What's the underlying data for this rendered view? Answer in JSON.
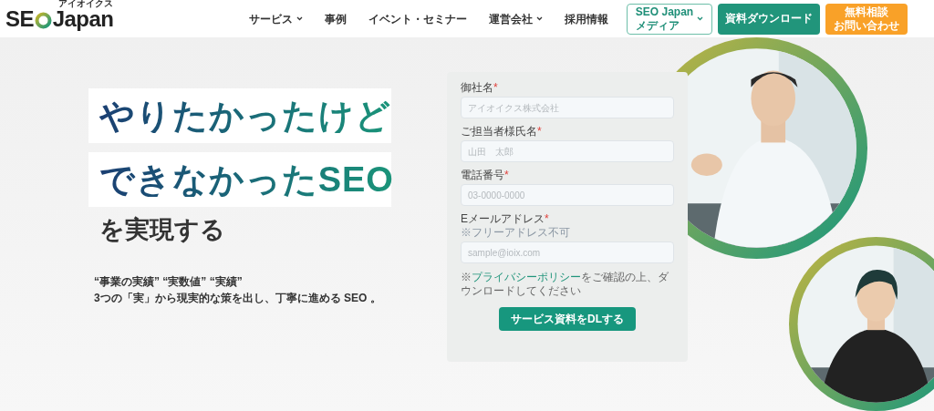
{
  "header": {
    "logo": {
      "before": "SE",
      "after": "Japan",
      "sub": "アイオイクス"
    },
    "nav": [
      {
        "label": "サービス",
        "dropdown": true
      },
      {
        "label": "事例",
        "dropdown": false
      },
      {
        "label": "イベント・セミナー",
        "dropdown": false
      },
      {
        "label": "運営会社",
        "dropdown": true
      },
      {
        "label": "採用情報",
        "dropdown": false
      }
    ],
    "buttons": [
      {
        "kind": "outline",
        "lines": [
          "SEO Japan",
          "メディア"
        ],
        "dropdown": true
      },
      {
        "kind": "green",
        "lines": [
          "資料ダウンロード"
        ],
        "dropdown": false
      },
      {
        "kind": "orange",
        "lines": [
          "無料相談",
          "お問い合わせ"
        ],
        "dropdown": false
      }
    ]
  },
  "hero": {
    "headline": [
      "やりたかったけど",
      "できなかったSEO"
    ],
    "subhead": "を実現する",
    "tagline": "“事業の実績” “実数値” “実績”",
    "description": "3つの「実」から現実的な策を出し、丁寧に進める SEO 。"
  },
  "form": {
    "required_mark": "*",
    "fields": [
      {
        "label": "御社名",
        "required": true,
        "placeholder": "アイオイクス株式会社"
      },
      {
        "label": "ご担当者様氏名",
        "required": true,
        "placeholder": "山田　太郎"
      },
      {
        "label": "電話番号",
        "required": true,
        "placeholder": "03-0000-0000"
      },
      {
        "label": "Eメールアドレス",
        "required": true,
        "note": "※フリーアドレス不可",
        "placeholder": "sample@ioix.com"
      }
    ],
    "consent": {
      "prefix": "※",
      "link": "プライバシーポリシー",
      "suffix": "をご確認の上、ダウンロードしてください"
    },
    "submit": "サービス資料をDLする"
  }
}
